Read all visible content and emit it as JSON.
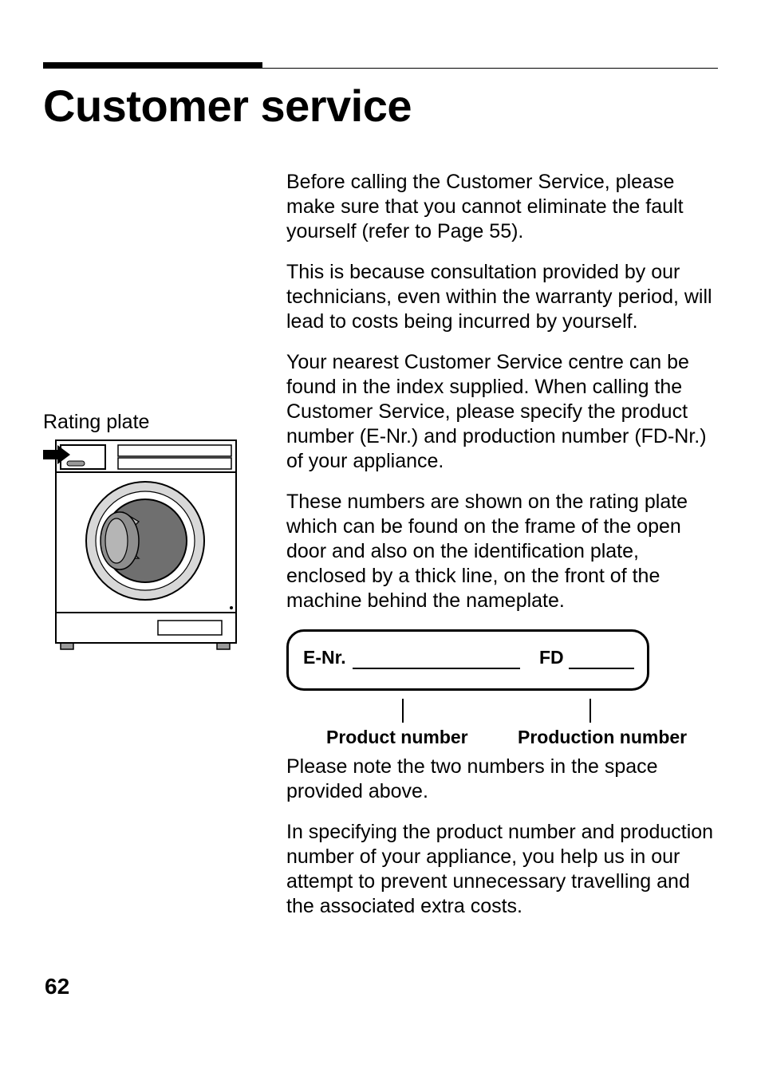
{
  "title": "Customer service",
  "leftCol": {
    "ratingLabel": "Rating plate"
  },
  "body": {
    "p1": "Before calling the Customer Service, please make sure that you cannot eliminate the fault yourself (refer to Page 55).",
    "p2": "This is because consultation provided by our technicians, even within the warranty period, will lead to costs being incurred by yourself.",
    "p3": "Your nearest Customer Service centre can be found in the index supplied. When calling the Customer Service, please specify the product number (E-Nr.) and production number (FD-Nr.) of your appliance.",
    "p4": "These numbers are shown on the rating plate which can be found on the frame of the open door and also on the identification plate, enclosed by a thick line, on the front of the machine behind the nameplate.",
    "plate": {
      "enrLabel": "E-Nr.",
      "fdLabel": "FD"
    },
    "captions": {
      "productNumber": "Product number",
      "productionNumber": "Production number"
    },
    "p5": "Please note the two numbers in the space provided above.",
    "p6": "In specifying the product number and production number of your appliance, you help us in our attempt to prevent unnecessary travelling and the associated extra costs."
  },
  "pageNumber": "62"
}
